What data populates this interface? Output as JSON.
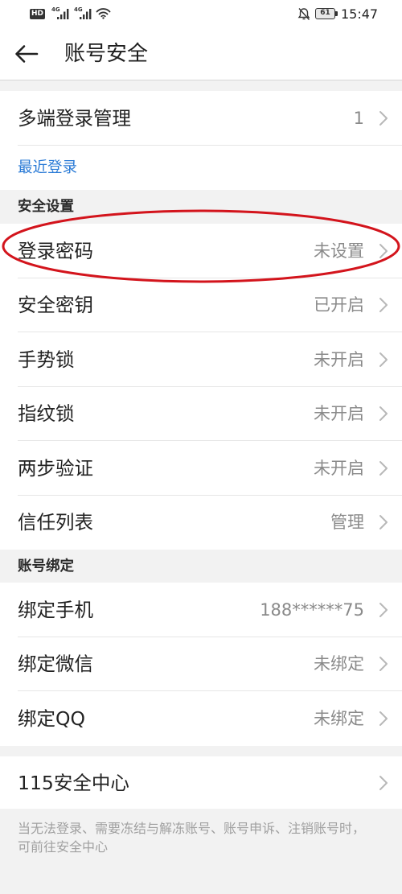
{
  "status_bar": {
    "hd_badge": "HD",
    "network_1": "4G",
    "network_2": "4G",
    "battery_level": "61",
    "time": "15:47"
  },
  "header": {
    "title": "账号安全"
  },
  "multi_device_login": {
    "label": "多端登录管理",
    "count": "1"
  },
  "recent_login": {
    "label": "最近登录"
  },
  "security_settings": {
    "title": "安全设置",
    "items": [
      {
        "label": "登录密码",
        "value": "未设置"
      },
      {
        "label": "安全密钥",
        "value": "已开启"
      },
      {
        "label": "手势锁",
        "value": "未开启"
      },
      {
        "label": "指纹锁",
        "value": "未开启"
      },
      {
        "label": "两步验证",
        "value": "未开启"
      },
      {
        "label": "信任列表",
        "value": "管理"
      }
    ]
  },
  "account_binding": {
    "title": "账号绑定",
    "items": [
      {
        "label": "绑定手机",
        "value": "188******75"
      },
      {
        "label": "绑定微信",
        "value": "未绑定"
      },
      {
        "label": "绑定QQ",
        "value": "未绑定"
      }
    ]
  },
  "security_center": {
    "label": "115安全中心"
  },
  "footer": {
    "note": "当无法登录、需要冻结与解冻账号、账号申诉、注销账号时，可前往安全中心"
  },
  "colors": {
    "accent_link": "#2b7bd6",
    "highlight_ellipse": "#d3141c",
    "page_background": "#f2f2f2",
    "value_text": "#8a8a8a"
  },
  "icons": {
    "back": "back-arrow-icon",
    "row_chevron": "chevron-right-icon",
    "wifi": "wifi-icon",
    "signal": "cellular-signal-icon",
    "do_not_disturb": "bell-off-icon",
    "battery": "battery-icon"
  }
}
